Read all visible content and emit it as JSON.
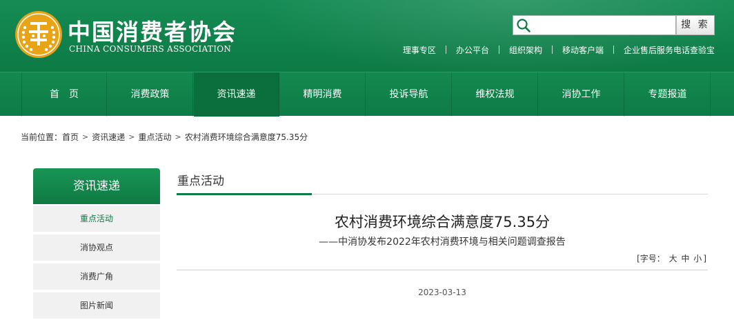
{
  "header": {
    "org_name_cn": "中国消费者协会",
    "org_name_en": "CHINA CONSUMERS ASSOCIATION",
    "search": {
      "placeholder": "",
      "button_label": "搜 索"
    },
    "top_links": [
      "理事专区",
      "办公平台",
      "组织架构",
      "移动客户端",
      "企业售后服务电话查验宝"
    ]
  },
  "nav": {
    "items": [
      "首　页",
      "消费政策",
      "资讯速递",
      "精明消费",
      "投诉导航",
      "维权法规",
      "消协工作",
      "专题报道"
    ],
    "active_index": 2
  },
  "breadcrumb": {
    "prefix": "当前位置：",
    "items": [
      "首页",
      "资讯速递",
      "重点活动",
      "农村消费环境综合满意度75.35分"
    ],
    "separator": ">"
  },
  "sidebar": {
    "title": "资讯速递",
    "items": [
      "重点活动",
      "消协观点",
      "消费广角",
      "图片新闻"
    ],
    "active_index": 0
  },
  "main": {
    "section_title": "重点活动",
    "article": {
      "title": "农村消费环境综合满意度75.35分",
      "subtitle": "——中消协发布2022年农村消费环境与相关问题调查报告",
      "font_size": {
        "label": "[字号：",
        "large": "大",
        "medium": "中",
        "small": "小",
        "close": "]"
      },
      "date": "2023-03-13"
    }
  },
  "colors": {
    "brand_green": "#0d7a43",
    "header_green": "#168c55",
    "logo_gold": "#e8a317",
    "sidebar_bg": "#f1f1f1"
  }
}
